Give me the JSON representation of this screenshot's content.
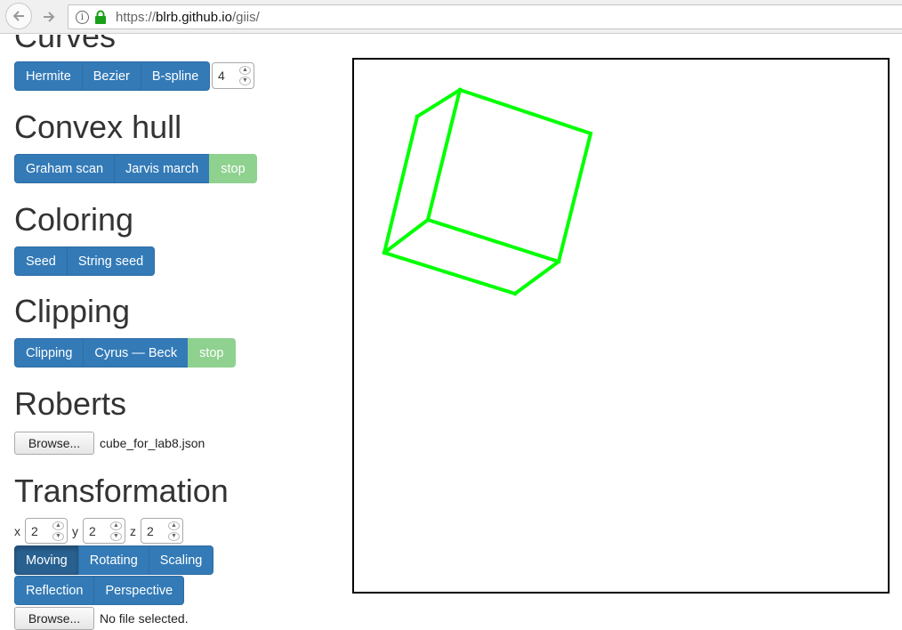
{
  "browser": {
    "url_scheme": "https://",
    "url_host": "blrb.github.io",
    "url_path": "/giis/",
    "back_icon": "arrow-left-icon",
    "forward_icon": "arrow-right-icon"
  },
  "curves": {
    "heading": "Curves",
    "buttons": [
      "Hermite",
      "Bezier",
      "B-spline"
    ],
    "spinner_value": "4"
  },
  "convex_hull": {
    "heading": "Convex hull",
    "buttons": [
      "Graham scan",
      "Jarvis march"
    ],
    "stop_label": "stop"
  },
  "coloring": {
    "heading": "Coloring",
    "buttons": [
      "Seed",
      "String seed"
    ]
  },
  "clipping": {
    "heading": "Clipping",
    "buttons": [
      "Clipping",
      "Cyrus — Beck"
    ],
    "stop_label": "stop"
  },
  "roberts": {
    "heading": "Roberts",
    "browse_label": "Browse...",
    "file_name": "cube_for_lab8.json"
  },
  "transformation": {
    "heading": "Transformation",
    "x_label": "x",
    "x_value": "2",
    "y_label": "y",
    "y_value": "2",
    "z_label": "z",
    "z_value": "2",
    "row1": [
      "Moving",
      "Rotating",
      "Scaling"
    ],
    "row2": [
      "Reflection",
      "Perspective"
    ],
    "browse_label": "Browse...",
    "file_status": "No file selected."
  },
  "canvas": {
    "stroke_color": "#00ff00"
  }
}
